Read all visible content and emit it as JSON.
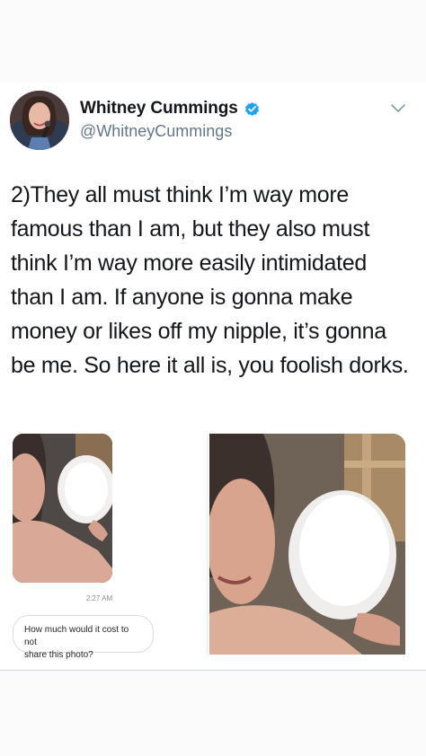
{
  "author": {
    "display_name": "Whitney Cummings",
    "handle": "@WhitneyCummings",
    "verified": true
  },
  "tweet": {
    "text": "2)They all must think I’m way more famous than I am, but they also must think I’m way more easily intimidated than I am. If anyone is gonna make money or likes off my nipple, it’s gonna be me. So here it all is, you foolish dorks."
  },
  "media": {
    "dm_screenshot": {
      "timestamp": "2:27 AM",
      "message_line1": "How much would it cost to not",
      "message_line2": "share this photo?"
    }
  },
  "icons": {
    "verified": "verified-badge-icon",
    "menu": "chevron-down-icon"
  },
  "colors": {
    "verified_blue": "#1da1f2",
    "secondary_text": "#657786"
  }
}
